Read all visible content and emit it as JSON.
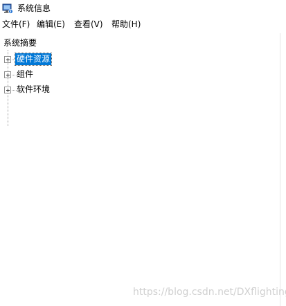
{
  "window": {
    "title": "系统信息",
    "icon": "system-info-icon"
  },
  "menu": [
    {
      "label": "文件(F)"
    },
    {
      "label": "编辑(E)"
    },
    {
      "label": "查看(V)"
    },
    {
      "label": "帮助(H)"
    }
  ],
  "tree": {
    "root": "系统摘要",
    "nodes": [
      {
        "label": "硬件资源",
        "selected": true,
        "expandable": true
      },
      {
        "label": "组件",
        "selected": false,
        "expandable": true
      },
      {
        "label": "软件环境",
        "selected": false,
        "expandable": true
      }
    ]
  },
  "watermark": "https://blog.csdn.net/DXflighting",
  "colors": {
    "selection": "#0078d7",
    "background": "#ffffff"
  }
}
